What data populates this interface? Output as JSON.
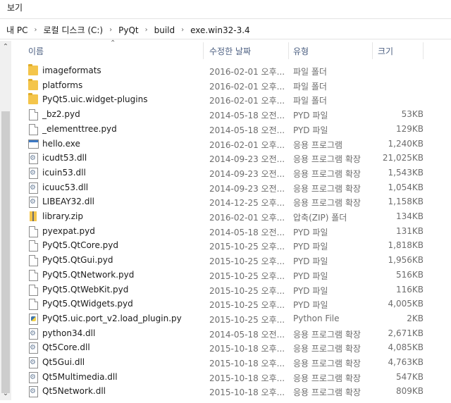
{
  "ribbon": {
    "tab_view": "보기"
  },
  "address": {
    "crumbs": [
      "내 PC",
      "로컬 디스크 (C:)",
      "PyQt",
      "build",
      "exe.win32-3.4"
    ]
  },
  "columns": {
    "name": "이름",
    "date": "수정한 날짜",
    "type": "유형",
    "size": "크기"
  },
  "files": [
    {
      "name": "imageformats",
      "date": "2016-02-01 오후...",
      "type": "파일 폴더",
      "size": "",
      "icon": "folder"
    },
    {
      "name": "platforms",
      "date": "2016-02-01 오후...",
      "type": "파일 폴더",
      "size": "",
      "icon": "folder"
    },
    {
      "name": "PyQt5.uic.widget-plugins",
      "date": "2016-02-01 오후...",
      "type": "파일 폴더",
      "size": "",
      "icon": "folder"
    },
    {
      "name": "_bz2.pyd",
      "date": "2014-05-18 오전...",
      "type": "PYD 파일",
      "size": "53KB",
      "icon": "file"
    },
    {
      "name": "_elementtree.pyd",
      "date": "2014-05-18 오전...",
      "type": "PYD 파일",
      "size": "129KB",
      "icon": "file"
    },
    {
      "name": "hello.exe",
      "date": "2016-02-01 오후...",
      "type": "응용 프로그램",
      "size": "1,240KB",
      "icon": "exe"
    },
    {
      "name": "icudt53.dll",
      "date": "2014-09-23 오전...",
      "type": "응용 프로그램 확장",
      "size": "21,025KB",
      "icon": "dll"
    },
    {
      "name": "icuin53.dll",
      "date": "2014-09-23 오전...",
      "type": "응용 프로그램 확장",
      "size": "1,543KB",
      "icon": "dll"
    },
    {
      "name": "icuuc53.dll",
      "date": "2014-09-23 오전...",
      "type": "응용 프로그램 확장",
      "size": "1,054KB",
      "icon": "dll"
    },
    {
      "name": "LIBEAY32.dll",
      "date": "2014-12-25 오후...",
      "type": "응용 프로그램 확장",
      "size": "1,158KB",
      "icon": "dll"
    },
    {
      "name": "library.zip",
      "date": "2016-02-01 오후...",
      "type": "압축(ZIP) 폴더",
      "size": "134KB",
      "icon": "zip"
    },
    {
      "name": "pyexpat.pyd",
      "date": "2014-05-18 오전...",
      "type": "PYD 파일",
      "size": "131KB",
      "icon": "file"
    },
    {
      "name": "PyQt5.QtCore.pyd",
      "date": "2015-10-25 오후...",
      "type": "PYD 파일",
      "size": "1,818KB",
      "icon": "file"
    },
    {
      "name": "PyQt5.QtGui.pyd",
      "date": "2015-10-25 오후...",
      "type": "PYD 파일",
      "size": "1,956KB",
      "icon": "file"
    },
    {
      "name": "PyQt5.QtNetwork.pyd",
      "date": "2015-10-25 오후...",
      "type": "PYD 파일",
      "size": "516KB",
      "icon": "file"
    },
    {
      "name": "PyQt5.QtWebKit.pyd",
      "date": "2015-10-25 오후...",
      "type": "PYD 파일",
      "size": "116KB",
      "icon": "file"
    },
    {
      "name": "PyQt5.QtWidgets.pyd",
      "date": "2015-10-25 오후...",
      "type": "PYD 파일",
      "size": "4,005KB",
      "icon": "file"
    },
    {
      "name": "PyQt5.uic.port_v2.load_plugin.py",
      "date": "2015-10-25 오후...",
      "type": "Python File",
      "size": "2KB",
      "icon": "py"
    },
    {
      "name": "python34.dll",
      "date": "2014-05-18 오전...",
      "type": "응용 프로그램 확장",
      "size": "2,671KB",
      "icon": "dll"
    },
    {
      "name": "Qt5Core.dll",
      "date": "2015-10-18 오후...",
      "type": "응용 프로그램 확장",
      "size": "4,085KB",
      "icon": "dll"
    },
    {
      "name": "Qt5Gui.dll",
      "date": "2015-10-18 오후...",
      "type": "응용 프로그램 확장",
      "size": "4,763KB",
      "icon": "dll"
    },
    {
      "name": "Qt5Multimedia.dll",
      "date": "2015-10-18 오후...",
      "type": "응용 프로그램 확장",
      "size": "547KB",
      "icon": "dll"
    },
    {
      "name": "Qt5Network.dll",
      "date": "2015-10-18 오후...",
      "type": "응용 프로그램 확장",
      "size": "809KB",
      "icon": "dll"
    }
  ]
}
